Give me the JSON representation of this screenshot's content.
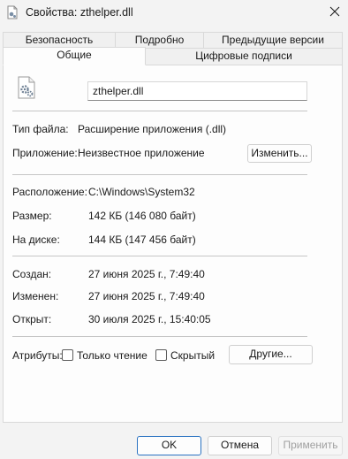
{
  "window": {
    "title": "Свойства: zthelper.dll"
  },
  "tabs": {
    "back_row": [
      "Безопасность",
      "Подробно",
      "Предыдущие версии"
    ],
    "front_row": [
      "Общие",
      "Цифровые подписи"
    ],
    "active": "Общие"
  },
  "general": {
    "file_name": "zthelper.dll",
    "file_type_label": "Тип файла:",
    "file_type_value": "Расширение приложения (.dll)",
    "app_label": "Приложение:",
    "app_value": "Неизвестное приложение",
    "change_button": "Изменить...",
    "location_label": "Расположение:",
    "location_value": "C:\\Windows\\System32",
    "size_label": "Размер:",
    "size_value": "142 КБ (146 080 байт)",
    "disk_label": "На диске:",
    "disk_value": "144 КБ (147 456 байт)",
    "created_label": "Создан:",
    "created_value": "27 июня 2025 г., 7:49:40",
    "modified_label": "Изменен:",
    "modified_value": "27 июня 2025 г., 7:49:40",
    "opened_label": "Открыт:",
    "opened_value": "30 июля 2025 г., 15:40:05",
    "attributes_label": "Атрибуты:",
    "readonly_label": "Только чтение",
    "readonly_checked": false,
    "hidden_label": "Скрытый",
    "hidden_checked": false,
    "other_button": "Другие..."
  },
  "footer": {
    "ok": "OK",
    "cancel": "Отмена",
    "apply": "Применить"
  },
  "colors": {
    "accent": "#2b73c2",
    "window_bg": "#f3f3f3",
    "panel_bg": "#fdfdfd"
  }
}
